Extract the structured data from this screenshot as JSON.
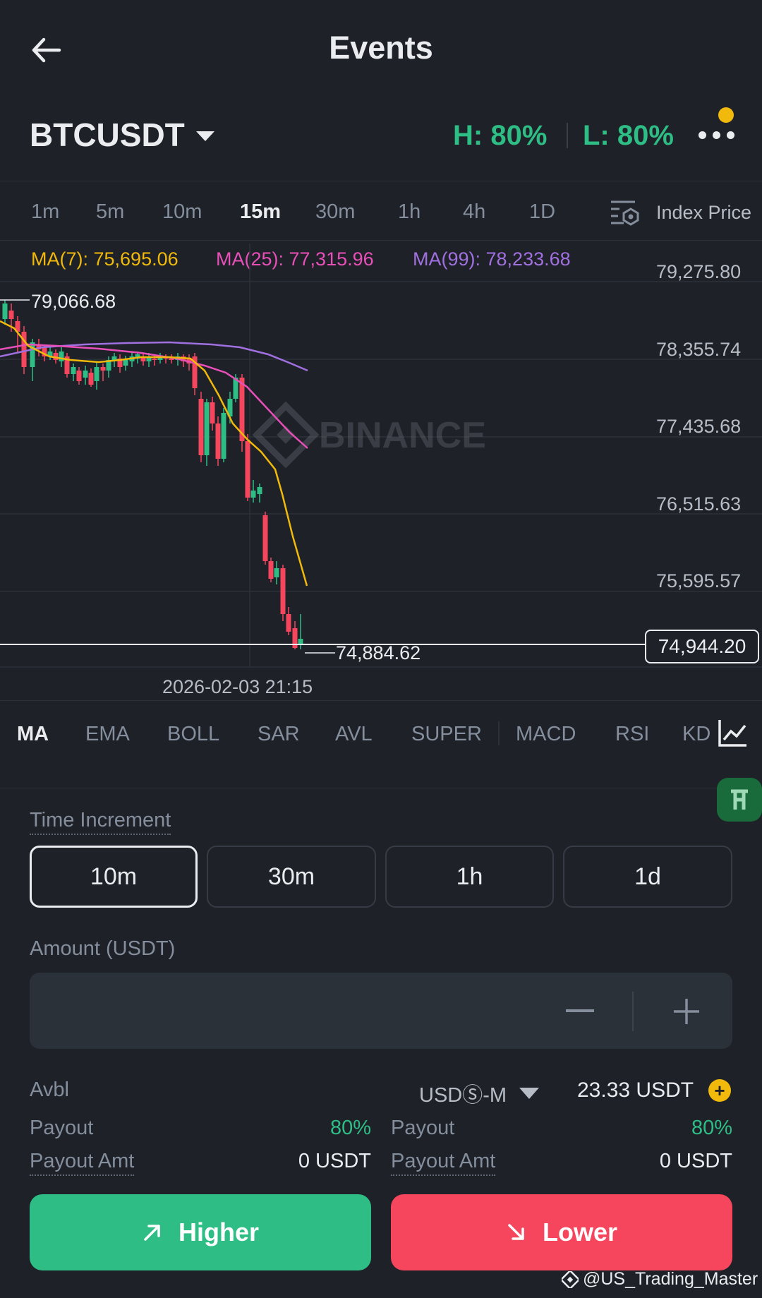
{
  "header": {
    "title": "Events",
    "back_icon": "arrow-left-icon"
  },
  "symbol": {
    "name": "BTCUSDT",
    "high": "H: 80%",
    "low": "L: 80%"
  },
  "intervals": [
    "1m",
    "5m",
    "10m",
    "15m",
    "30m",
    "1h",
    "4h",
    "1D"
  ],
  "active_interval": "15m",
  "index_price_label": "Index Price",
  "ma": {
    "ma7": "MA(7): 75,695.06",
    "ma25": "MA(25): 77,315.96",
    "ma99": "MA(99): 78,233.68"
  },
  "chart_data": {
    "type": "candlestick",
    "y_ticks": [
      "79,275.80",
      "78,355.74",
      "77,435.68",
      "76,515.63",
      "75,595.57"
    ],
    "last_price": "74,944.20",
    "high_marker": "79,066.68",
    "low_marker": "74,884.62",
    "time_label": "2026-02-03 21:15",
    "watermark": "BINANCE",
    "colors": {
      "up": "#2ebd85",
      "down": "#f6465d",
      "ma7": "#f0b90b",
      "ma25": "#e84fb8",
      "ma99": "#a070e0"
    }
  },
  "indicators": [
    "MA",
    "EMA",
    "BOLL",
    "SAR",
    "AVL",
    "SUPER",
    "MACD",
    "RSI",
    "KD"
  ],
  "active_indicator": "MA",
  "time_increment": {
    "label": "Time Increment",
    "options": [
      "10m",
      "30m",
      "1h",
      "1d"
    ],
    "selected": "10m"
  },
  "amount": {
    "label": "Amount (USDT)",
    "value": ""
  },
  "avbl": {
    "label": "Avbl",
    "margin_mode": "USDⓈ-M",
    "balance": "23.33 USDT"
  },
  "left": {
    "payout_label": "Payout",
    "payout": "80%",
    "payout_amt_label": "Payout Amt",
    "payout_amt": "0 USDT"
  },
  "right": {
    "payout_label": "Payout",
    "payout": "80%",
    "payout_amt_label": "Payout Amt",
    "payout_amt": "0 USDT"
  },
  "buttons": {
    "higher": "Higher",
    "lower": "Lower"
  },
  "watermark": "@US_Trading_Master"
}
